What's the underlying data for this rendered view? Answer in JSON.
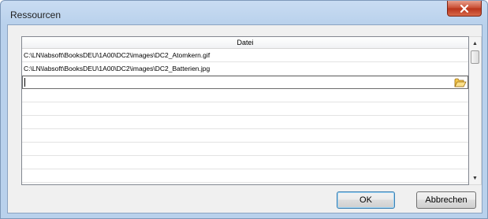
{
  "window": {
    "title": "Ressourcen",
    "close_glyph": "x"
  },
  "grid": {
    "column_header": "Datei",
    "rows": [
      "C:\\LN\\labsoft\\BooksDEU\\1A00\\DC2\\images\\DC2_Atomkern.gif",
      "C:\\LN\\labsoft\\BooksDEU\\1A00\\DC2\\images\\DC2_Batterien.jpg"
    ],
    "edit_value": "",
    "browse_icon": "folder-open-icon"
  },
  "scrollbar": {
    "up_arrow": "▲",
    "down_arrow": "▼"
  },
  "buttons": {
    "ok_label": "OK",
    "cancel_label": "Abbrechen"
  },
  "colors": {
    "frame": "#b9d1ec",
    "close": "#c74a2f",
    "default_button_border": "#3c7fb1"
  }
}
